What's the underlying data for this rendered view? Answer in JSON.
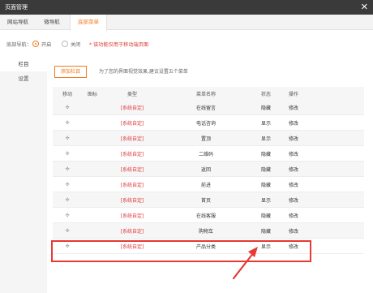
{
  "window": {
    "title": "页面管理",
    "close_glyph": "✕"
  },
  "tabs": [
    {
      "label": "网站导航"
    },
    {
      "label": "微导航"
    },
    {
      "label": "底部菜单"
    }
  ],
  "nav_row": {
    "label": "底部导航：",
    "options": [
      {
        "label": "开启",
        "selected": true
      },
      {
        "label": "关闭",
        "selected": false
      }
    ],
    "note": "* 该功能仅用于移动端页面"
  },
  "sidebar": {
    "items": [
      {
        "label": "栏目"
      },
      {
        "label": "设置"
      }
    ]
  },
  "toolbar": {
    "add_label": "添加栏目",
    "hint": "为了您的界面视觉效果,建议设置五个菜单"
  },
  "table": {
    "headers": [
      "移动",
      "图标",
      "类型",
      "菜单名称",
      "状态",
      "操作"
    ],
    "move_glyph": "✣",
    "rows": [
      {
        "type": "[系统自定]",
        "name": "在线留言",
        "status": "隐藏",
        "action": "修改"
      },
      {
        "type": "[系统自定]",
        "name": "电话咨询",
        "status": "显示",
        "action": "修改"
      },
      {
        "type": "[系统自定]",
        "name": "置顶",
        "status": "显示",
        "action": "修改"
      },
      {
        "type": "[系统自定]",
        "name": "二维码",
        "status": "隐藏",
        "action": "修改"
      },
      {
        "type": "[系统自定]",
        "name": "返回",
        "status": "隐藏",
        "action": "修改"
      },
      {
        "type": "[系统自定]",
        "name": "前进",
        "status": "隐藏",
        "action": "修改"
      },
      {
        "type": "[系统自定]",
        "name": "首页",
        "status": "显示",
        "action": "修改"
      },
      {
        "type": "[系统自定]",
        "name": "在线客服",
        "status": "隐藏",
        "action": "修改"
      },
      {
        "type": "[系统自定]",
        "name": "购物车",
        "status": "隐藏",
        "action": "修改"
      },
      {
        "type": "[系统自定]",
        "name": "产品分类",
        "status": "显示",
        "action": "修改"
      }
    ]
  },
  "colors": {
    "accent": "#f07b22",
    "annotation": "#e63a32",
    "type_text": "#e03a3a",
    "titlebar": "#3a3a3a"
  }
}
